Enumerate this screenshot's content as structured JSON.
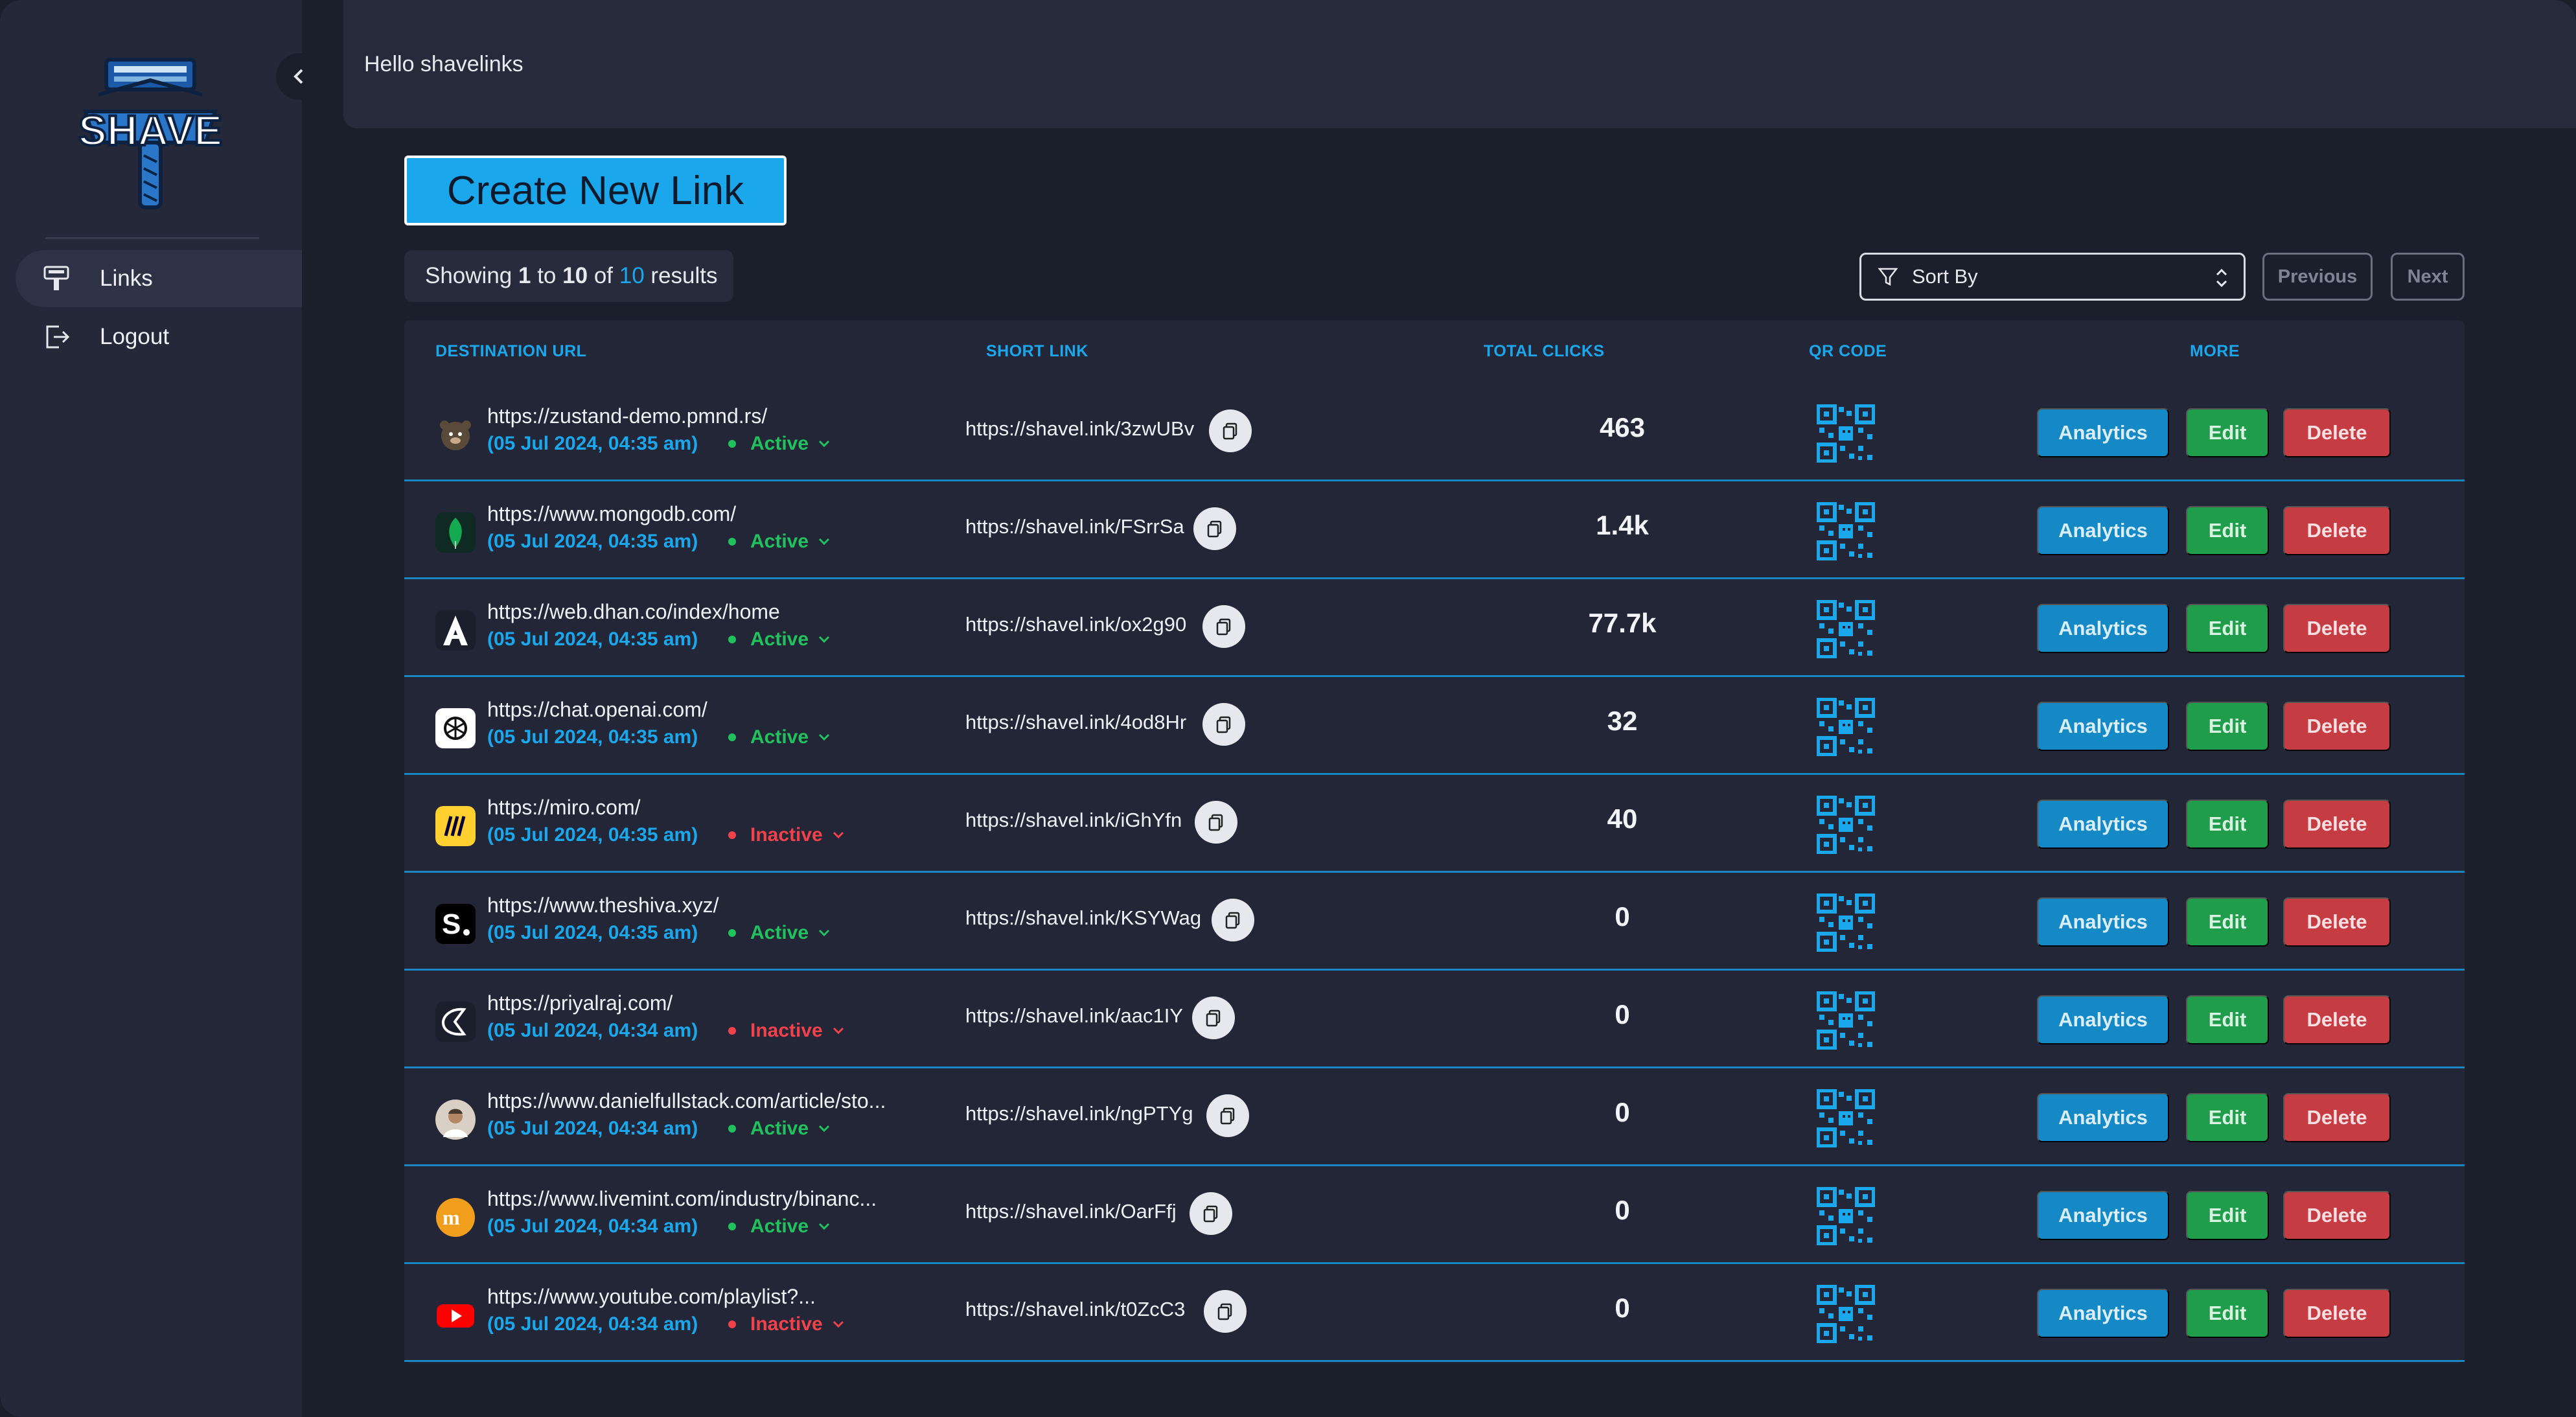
{
  "app": {
    "logo_text": "SHAVE",
    "greeting": "Hello shavelinks"
  },
  "sidebar": {
    "items": [
      {
        "label": "Links",
        "icon": "links-icon",
        "active": true
      },
      {
        "label": "Logout",
        "icon": "logout-icon",
        "active": false
      }
    ]
  },
  "toolbar": {
    "create_label": "Create New Link",
    "showing_prefix": "Showing",
    "showing_from": "1",
    "showing_to_word": "to",
    "showing_to": "10",
    "showing_of_word": "of",
    "showing_total": "10",
    "showing_suffix": "results",
    "sort_placeholder": "Sort By",
    "previous_label": "Previous",
    "next_label": "Next"
  },
  "table": {
    "headers": {
      "destination": "DESTINATION URL",
      "short": "SHORT LINK",
      "clicks": "TOTAL CLICKS",
      "qr": "QR CODE",
      "more": "MORE"
    },
    "buttons": {
      "analytics": "Analytics",
      "edit": "Edit",
      "delete": "Delete"
    },
    "rows": [
      {
        "url": "https://zustand-demo.pmnd.rs/",
        "date": "(05 Jul 2024, 04:35 am)",
        "status": "Active",
        "short": "https://shavel.ink/3zwUBv",
        "clicks": "463",
        "favicon": "bear-favicon"
      },
      {
        "url": "https://www.mongodb.com/",
        "date": "(05 Jul 2024, 04:35 am)",
        "status": "Active",
        "short": "https://shavel.ink/FSrrSa",
        "clicks": "1.4k",
        "favicon": "leaf-favicon"
      },
      {
        "url": "https://web.dhan.co/index/home",
        "date": "(05 Jul 2024, 04:35 am)",
        "status": "Active",
        "short": "https://shavel.ink/ox2g90",
        "clicks": "77.7k",
        "favicon": "dhan-favicon"
      },
      {
        "url": "https://chat.openai.com/",
        "date": "(05 Jul 2024, 04:35 am)",
        "status": "Active",
        "short": "https://shavel.ink/4od8Hr",
        "clicks": "32",
        "favicon": "openai-favicon"
      },
      {
        "url": "https://miro.com/",
        "date": "(05 Jul 2024, 04:35 am)",
        "status": "Inactive",
        "short": "https://shavel.ink/iGhYfn",
        "clicks": "40",
        "favicon": "miro-favicon"
      },
      {
        "url": "https://www.theshiva.xyz/",
        "date": "(05 Jul 2024, 04:35 am)",
        "status": "Active",
        "short": "https://shavel.ink/KSYWag",
        "clicks": "0",
        "favicon": "shiva-favicon"
      },
      {
        "url": "https://priyalraj.com/",
        "date": "(05 Jul 2024, 04:34 am)",
        "status": "Inactive",
        "short": "https://shavel.ink/aac1IY",
        "clicks": "0",
        "favicon": "priyal-favicon"
      },
      {
        "url": "https://www.danielfullstack.com/article/sto...",
        "date": "(05 Jul 2024, 04:34 am)",
        "status": "Active",
        "short": "https://shavel.ink/ngPTYg",
        "clicks": "0",
        "favicon": "avatar-favicon"
      },
      {
        "url": "https://www.livemint.com/industry/binanc...",
        "date": "(05 Jul 2024, 04:34 am)",
        "status": "Active",
        "short": "https://shavel.ink/OarFfj",
        "clicks": "0",
        "favicon": "mint-favicon"
      },
      {
        "url": "https://www.youtube.com/playlist?...",
        "date": "(05 Jul 2024, 04:34 am)",
        "status": "Inactive",
        "short": "https://shavel.ink/t0ZcC3",
        "clicks": "0",
        "favicon": "youtube-favicon"
      }
    ]
  },
  "colors": {
    "accent": "#1aa7ec",
    "active": "#21c25e",
    "inactive": "#f0424b",
    "analytics": "#1589c5",
    "edit": "#1f9d4a",
    "delete": "#c53c43"
  }
}
